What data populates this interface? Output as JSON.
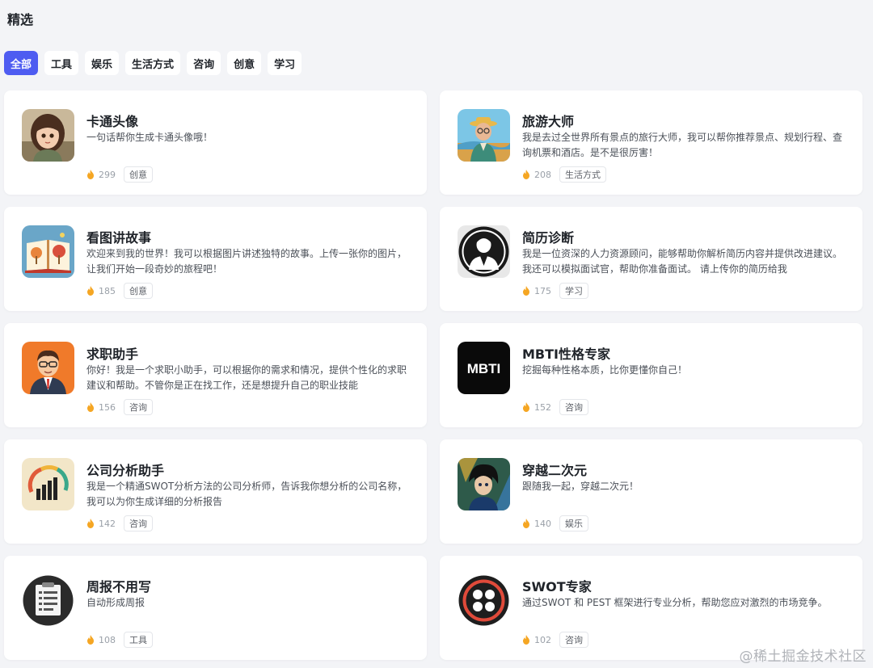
{
  "section_title": "精选",
  "tabs": [
    {
      "label": "全部",
      "active": true
    },
    {
      "label": "工具",
      "active": false
    },
    {
      "label": "娱乐",
      "active": false
    },
    {
      "label": "生活方式",
      "active": false
    },
    {
      "label": "咨询",
      "active": false
    },
    {
      "label": "创意",
      "active": false
    },
    {
      "label": "学习",
      "active": false
    }
  ],
  "cards": [
    {
      "title": "卡通头像",
      "desc": "一句话帮你生成卡通头像哦！",
      "count": "299",
      "tag": "创意",
      "icon": "cartoon-girl-avatar-icon"
    },
    {
      "title": "旅游大师",
      "desc": "我是去过全世界所有景点的旅行大师，我可以帮你推荐景点、规划行程、查询机票和酒店。是不是很厉害！",
      "count": "208",
      "tag": "生活方式",
      "icon": "traveler-avatar-icon"
    },
    {
      "title": "看图讲故事",
      "desc": "欢迎来到我的世界！我可以根据图片讲述独特的故事。上传一张你的图片，让我们开始一段奇妙的旅程吧！",
      "count": "185",
      "tag": "创意",
      "icon": "storybook-icon"
    },
    {
      "title": "简历诊断",
      "desc": "我是一位资深的人力资源顾问，能够帮助你解析简历内容并提供改进建议。我还可以模拟面试官，帮助你准备面试。 请上传你的简历给我",
      "count": "175",
      "tag": "学习",
      "icon": "hr-consultant-icon"
    },
    {
      "title": "求职助手",
      "desc": "你好！我是一个求职小助手，可以根据你的需求和情况，提供个性化的求职建议和帮助。不管你是正在找工作，还是想提升自己的职业技能",
      "count": "156",
      "tag": "咨询",
      "icon": "job-assistant-icon"
    },
    {
      "title": "MBTI性格专家",
      "desc": "挖掘每种性格本质，比你更懂你自己！",
      "count": "152",
      "tag": "咨询",
      "icon": "mbti-logo-icon",
      "logo_text": "MBTI"
    },
    {
      "title": "公司分析助手",
      "desc": "我是一个精通SWOT分析方法的公司分析师，告诉我你想分析的公司名称，我可以为你生成详细的分析报告",
      "count": "142",
      "tag": "咨询",
      "icon": "bar-chart-gauge-icon"
    },
    {
      "title": "穿越二次元",
      "desc": "跟随我一起，穿越二次元！",
      "count": "140",
      "tag": "娱乐",
      "icon": "anime-character-icon"
    },
    {
      "title": "周报不用写",
      "desc": "自动形成周报",
      "count": "108",
      "tag": "工具",
      "icon": "report-document-icon"
    },
    {
      "title": "SWOT专家",
      "desc": "通过SWOT 和 PEST 框架进行专业分析，帮助您应对激烈的市场竞争。",
      "count": "102",
      "tag": "咨询",
      "icon": "swot-logo-icon"
    }
  ],
  "watermark": "@稀土掘金技术社区",
  "colors": {
    "accent": "#4e5cf1",
    "fire": "#f5a623",
    "background": "#f3f4f7"
  }
}
